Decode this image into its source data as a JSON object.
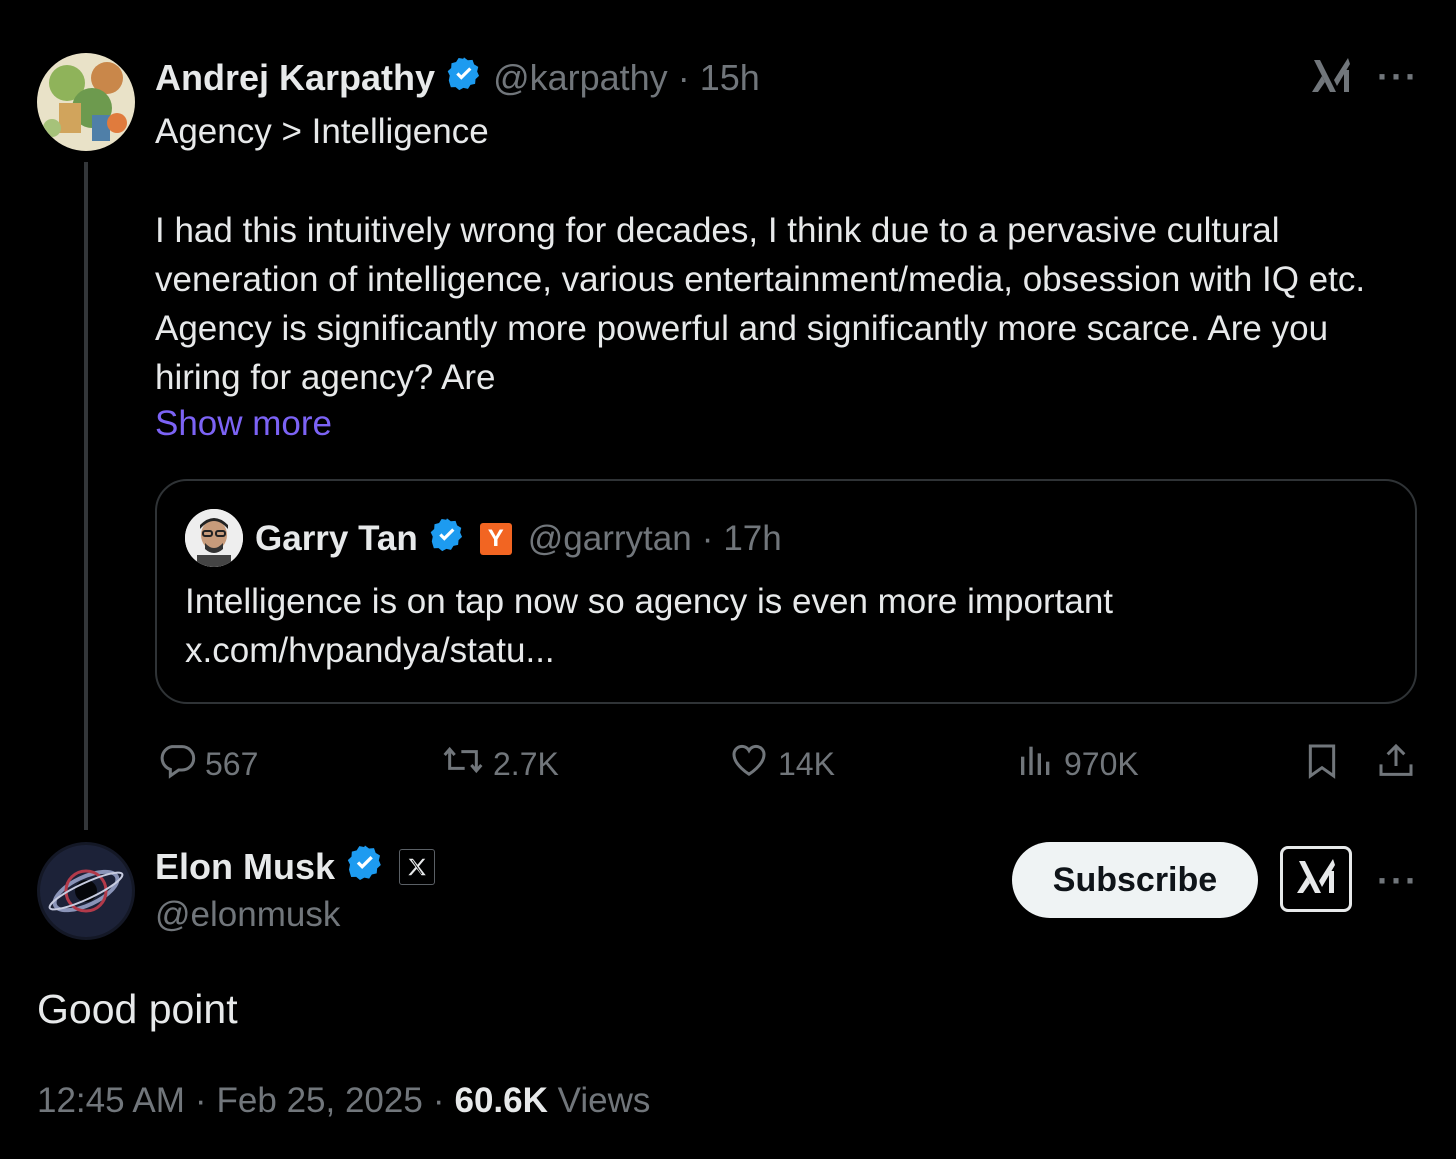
{
  "parent_tweet": {
    "author_name": "Andrej Karpathy",
    "handle": "@karpathy",
    "separator": "·",
    "time": "15h",
    "title_line": "Agency > Intelligence",
    "body": "I had this intuitively wrong for decades, I think due to a pervasive cultural veneration of intelligence, various entertainment/media, obsession with IQ etc. Agency is significantly more powerful and significantly more scarce. Are you hiring for agency? Are",
    "show_more": "Show more",
    "quote": {
      "author_name": "Garry Tan",
      "badge_letter": "Y",
      "handle": "@garrytan",
      "separator": "·",
      "time": "17h",
      "text_line1": "Intelligence is on tap now so agency is even more important",
      "text_line2": "x.com/hvpandya/statu..."
    },
    "actions": {
      "replies": "567",
      "reposts": "2.7K",
      "likes": "14K",
      "views": "970K"
    }
  },
  "main_tweet": {
    "author_name": "Elon Musk",
    "handle": "@elonmusk",
    "subscribe_label": "Subscribe",
    "text": "Good point",
    "time": "12:45 AM",
    "separator": "·",
    "date": "Feb 25, 2025",
    "separator2": "·",
    "views_count": "60.6K",
    "views_label": "Views"
  },
  "icons": [
    "verified-badge-icon",
    "grok-icon",
    "more-icon",
    "reply-icon",
    "repost-icon",
    "like-icon",
    "views-icon",
    "bookmark-icon",
    "share-icon",
    "x-logo-icon",
    "ycombinator-badge-icon"
  ],
  "colors": {
    "background": "#000000",
    "text": "#e7e9ea",
    "muted": "#71767b",
    "link": "#7c63f5",
    "verified": "#1d9bf0",
    "yc": "#f26522",
    "border": "#2f3336"
  }
}
